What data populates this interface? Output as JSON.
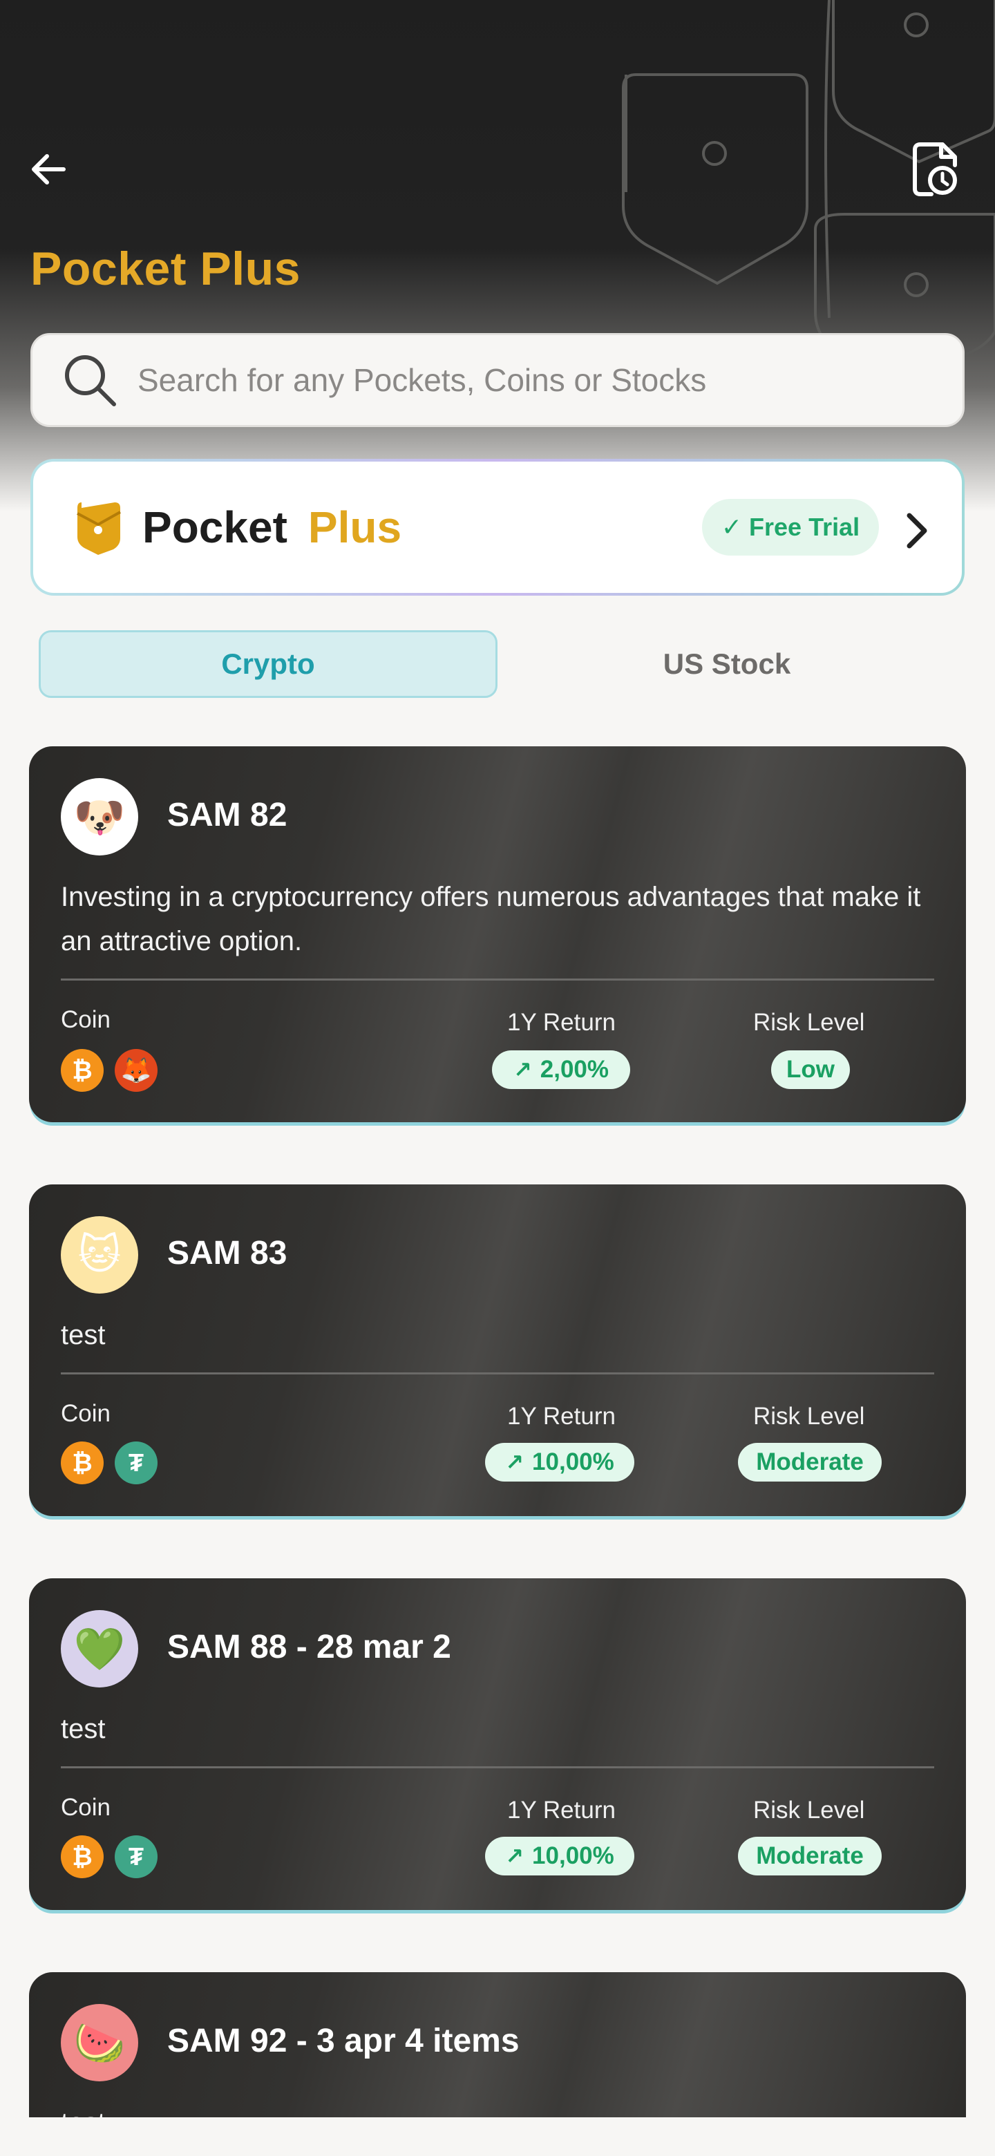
{
  "header": {
    "title": "Pocket Plus",
    "back_icon": "arrow-left-icon",
    "history_icon": "file-history-icon"
  },
  "search": {
    "placeholder": "Search for any Pockets, Coins or Stocks",
    "icon": "search-icon"
  },
  "promo": {
    "brand_word1": "Pocket",
    "brand_word2": "Plus",
    "badge": "Free Trial",
    "logo_icon": "pocket-logo-icon",
    "chevron_icon": "chevron-right-icon"
  },
  "tabs": [
    {
      "label": "Crypto",
      "active": true
    },
    {
      "label": "US Stock",
      "active": false
    }
  ],
  "column_labels": {
    "coin": "Coin",
    "return": "1Y Return",
    "risk": "Risk Level"
  },
  "pockets": [
    {
      "name": "SAM 82",
      "avatar": "🐶",
      "description": "Investing in a cryptocurrency offers numerous advantages that make it an attractive option.",
      "coins": [
        "btc",
        "shib"
      ],
      "return": "2,00%",
      "risk": "Low"
    },
    {
      "name": "SAM 83",
      "avatar": "🐱",
      "description": "test",
      "coins": [
        "btc",
        "usdt"
      ],
      "return": "10,00%",
      "risk": "Moderate"
    },
    {
      "name": "SAM 88 - 28 mar 2",
      "avatar": "💚",
      "description": "test",
      "coins": [
        "btc",
        "usdt"
      ],
      "return": "10,00%",
      "risk": "Moderate"
    },
    {
      "name": "SAM 92 - 3 apr 4 items",
      "avatar": "🍉",
      "description": "test"
    }
  ],
  "colors": {
    "accent_gold": "#e5a928",
    "tab_active": "#1f9eab",
    "positive_green": "#1aa062"
  }
}
